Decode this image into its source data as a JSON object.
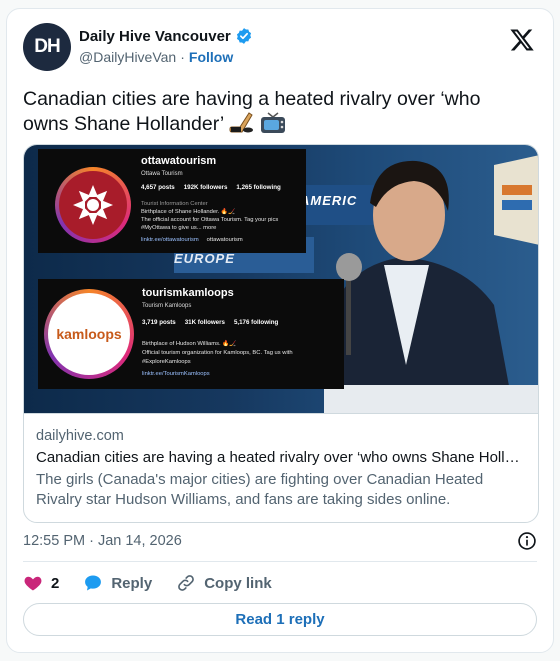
{
  "author": {
    "name": "Daily Hive Vancouver",
    "handle": "@DailyHiveVan",
    "separator": "·",
    "follow_label": "Follow",
    "avatar_text": "DH"
  },
  "tweet": {
    "text": "Canadian cities are having a heated rivalry over ‘who owns Shane Hollander’"
  },
  "media": {
    "ottawa": {
      "username": "ottawatourism",
      "display_name": "Ottawa Tourism",
      "posts": "4,657 posts",
      "followers": "192K followers",
      "following": "1,265 following",
      "category": "Tourist Information Center",
      "bio1": "Birthplace of Shane Hollander. 🔥🏒",
      "bio2": "The official account for Ottawa Tourism. Tag your pics",
      "bio3": "#MyOttawa to give us... more",
      "link": "linktr.ee/ottawatourism",
      "threads": "ottawatourism"
    },
    "kamloops": {
      "username": "tourismkamloops",
      "display_name": "Tourism Kamloops",
      "logo_text": "kamloops",
      "posts": "3,719 posts",
      "followers": "31K followers",
      "following": "5,176 following",
      "bio1": "Birthplace of Hudson Williams. 🔥🏒",
      "bio2": "Official tourism organization for Kamloops, BC. Tag us with",
      "bio3": "#ExploreKamloops",
      "link": "linktr.ee/TourismKamloops"
    },
    "background_text1": "AMERIC",
    "background_text2": "EUROPE"
  },
  "link_card": {
    "domain": "dailyhive.com",
    "title": "Canadian cities are having a heated rivalry over ‘who owns Shane Holl…",
    "description": "The girls (Canada's major cities) are fighting over Canadian Heated Rivalry star Hudson Williams, and fans are taking sides online."
  },
  "timestamp": "12:55 PM · Jan 14, 2026",
  "actions": {
    "like_count": "2",
    "reply_label": "Reply",
    "copy_label": "Copy link"
  },
  "read_replies_label": "Read 1 reply",
  "colors": {
    "link_blue": "#1d6fb8",
    "verified_blue": "#1d9bf0",
    "like_pink": "#c9267a",
    "secondary_text": "#536471"
  }
}
